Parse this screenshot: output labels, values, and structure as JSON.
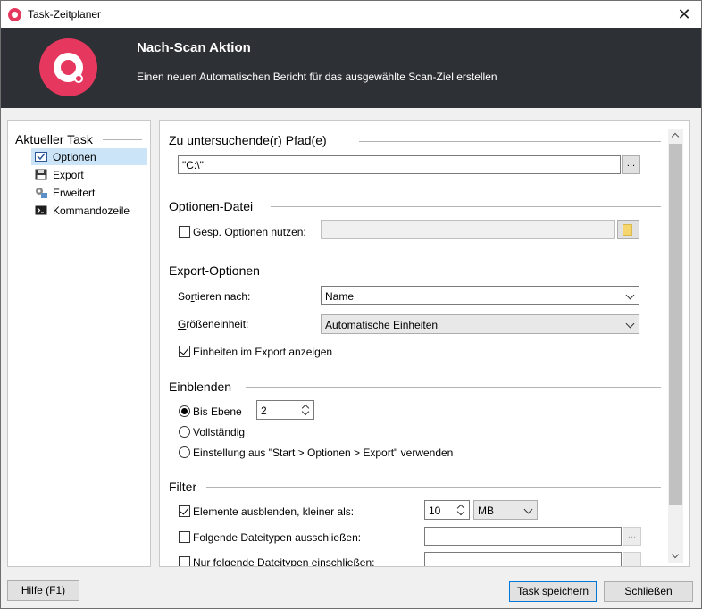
{
  "window": {
    "title": "Task-Zeitplaner",
    "close_icon": "close-icon"
  },
  "header": {
    "title": "Nach-Scan Aktion",
    "subtitle": "Einen neuen Automatischen Bericht für das ausgewählte Scan-Ziel erstellen",
    "logo": "treesize-logo"
  },
  "sidebar": {
    "heading": "Aktueller Task",
    "items": [
      {
        "label": "Optionen",
        "icon": "options-icon",
        "selected": true
      },
      {
        "label": "Export",
        "icon": "floppy-disk-icon"
      },
      {
        "label": "Erweitert",
        "icon": "advanced-settings-icon"
      },
      {
        "label": "Kommandozeile",
        "icon": "console-icon"
      }
    ]
  },
  "paths": {
    "title_pre": "Zu untersuchende(r) ",
    "title_u": "P",
    "title_post": "fad(e)",
    "value": "\"C:\\\"",
    "browse": "..."
  },
  "options_file": {
    "title": "Optionen-Datei",
    "use_saved_label": "Gesp. Optionen nutzen:",
    "use_saved_checked": false,
    "path_value": ""
  },
  "export_options": {
    "title": "Export-Optionen",
    "sort_label_pre": "So",
    "sort_label_u": "r",
    "sort_label_post": "tieren nach:",
    "sort_value": "Name",
    "size_unit_label_pre": "",
    "size_unit_label_u": "G",
    "size_unit_label_post": "rößeneinheit:",
    "size_unit_value": "Automatische Einheiten",
    "show_units_label": "Einheiten im Export anzeigen",
    "show_units_checked": true
  },
  "expand": {
    "title": "Einblenden",
    "level_label": "Bis Ebene",
    "level_value": "2",
    "full_label": "Vollständig",
    "setting_label": "Einstellung aus \"Start > Optionen > Export\" verwenden",
    "selected": "level"
  },
  "filter": {
    "title": "Filter",
    "hide_smaller_label": "Elemente ausblenden, kleiner als:",
    "hide_smaller_checked": true,
    "hide_smaller_value": "10",
    "hide_smaller_unit": "MB",
    "exclude_types_label": "Folgende Dateitypen ausschließen:",
    "exclude_types_checked": false,
    "exclude_types_value": "",
    "include_types_label": "Nur folgende Dateitypen einschließen:",
    "include_types_checked": false
  },
  "footer": {
    "help": "Hilfe (F1)",
    "save": "Task speichern",
    "close": "Schließen"
  }
}
